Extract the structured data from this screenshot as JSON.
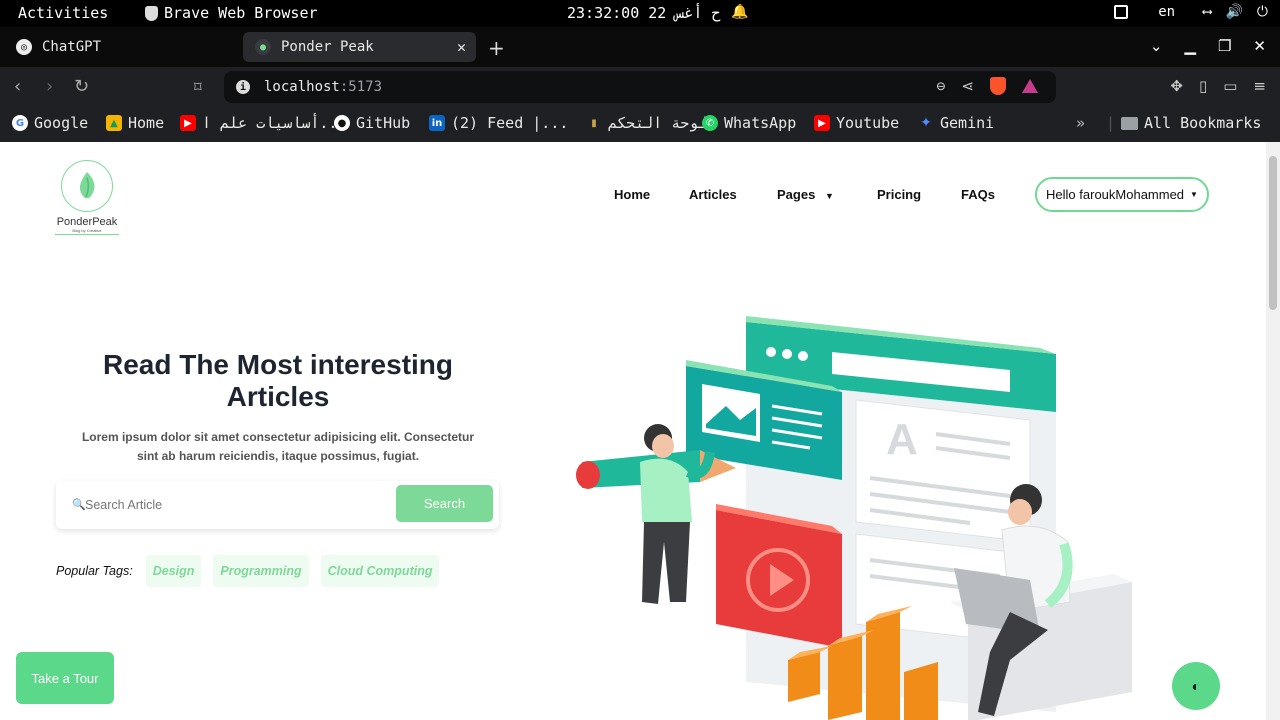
{
  "system_bar": {
    "activities": "Activities",
    "app_name": "Brave Web Browser",
    "clock": "23:32:00 22 ح أغس",
    "language": "en"
  },
  "tabs": [
    {
      "label": "ChatGPT",
      "active": false
    },
    {
      "label": "Ponder Peak",
      "active": true
    }
  ],
  "url": {
    "host": "localhost",
    "port": ":5173"
  },
  "bookmarks": [
    {
      "label": "Google",
      "icon": "google-icon",
      "color": "#ffffff"
    },
    {
      "label": "Home",
      "icon": "home-icon",
      "color": "#f4b400"
    },
    {
      "label": "أساسيات علم ا...",
      "icon": "youtube-icon",
      "color": "#ff0000"
    },
    {
      "label": "GitHub",
      "icon": "github-icon",
      "color": "#ffffff"
    },
    {
      "label": "(2) Feed |...",
      "icon": "linkedin-icon",
      "color": "#0a66c2"
    },
    {
      "label": "لوحة التحكم",
      "icon": "dashboard-icon",
      "color": "#c8a24a"
    },
    {
      "label": "WhatsApp",
      "icon": "whatsapp-icon",
      "color": "#25d366"
    },
    {
      "label": "Youtube",
      "icon": "youtube-icon",
      "color": "#ff0000"
    },
    {
      "label": "Gemini",
      "icon": "gemini-icon",
      "color": "#4f8cff"
    }
  ],
  "all_bookmarks": "All Bookmarks",
  "site": {
    "logo_name": "PonderPeak",
    "logo_tagline": "Blog by Creative",
    "nav": [
      "Home",
      "Articles",
      "Pages",
      "Pricing",
      "FAQs"
    ],
    "user_greeting": "Hello faroukMohammed",
    "hero_title": "Read The Most interesting Articles",
    "hero_desc": "Lorem ipsum dolor sit amet consectetur adipisicing elit. Consectetur sint ab harum reiciendis, itaque possimus, fugiat.",
    "search_placeholder": "Search Article",
    "search_button": "Search",
    "popular_tags_label": "Popular Tags:",
    "tags": [
      "Design",
      "Programming",
      "Cloud Computing"
    ],
    "tour_button": "Take a Tour",
    "accent_color": "#7dd998"
  }
}
